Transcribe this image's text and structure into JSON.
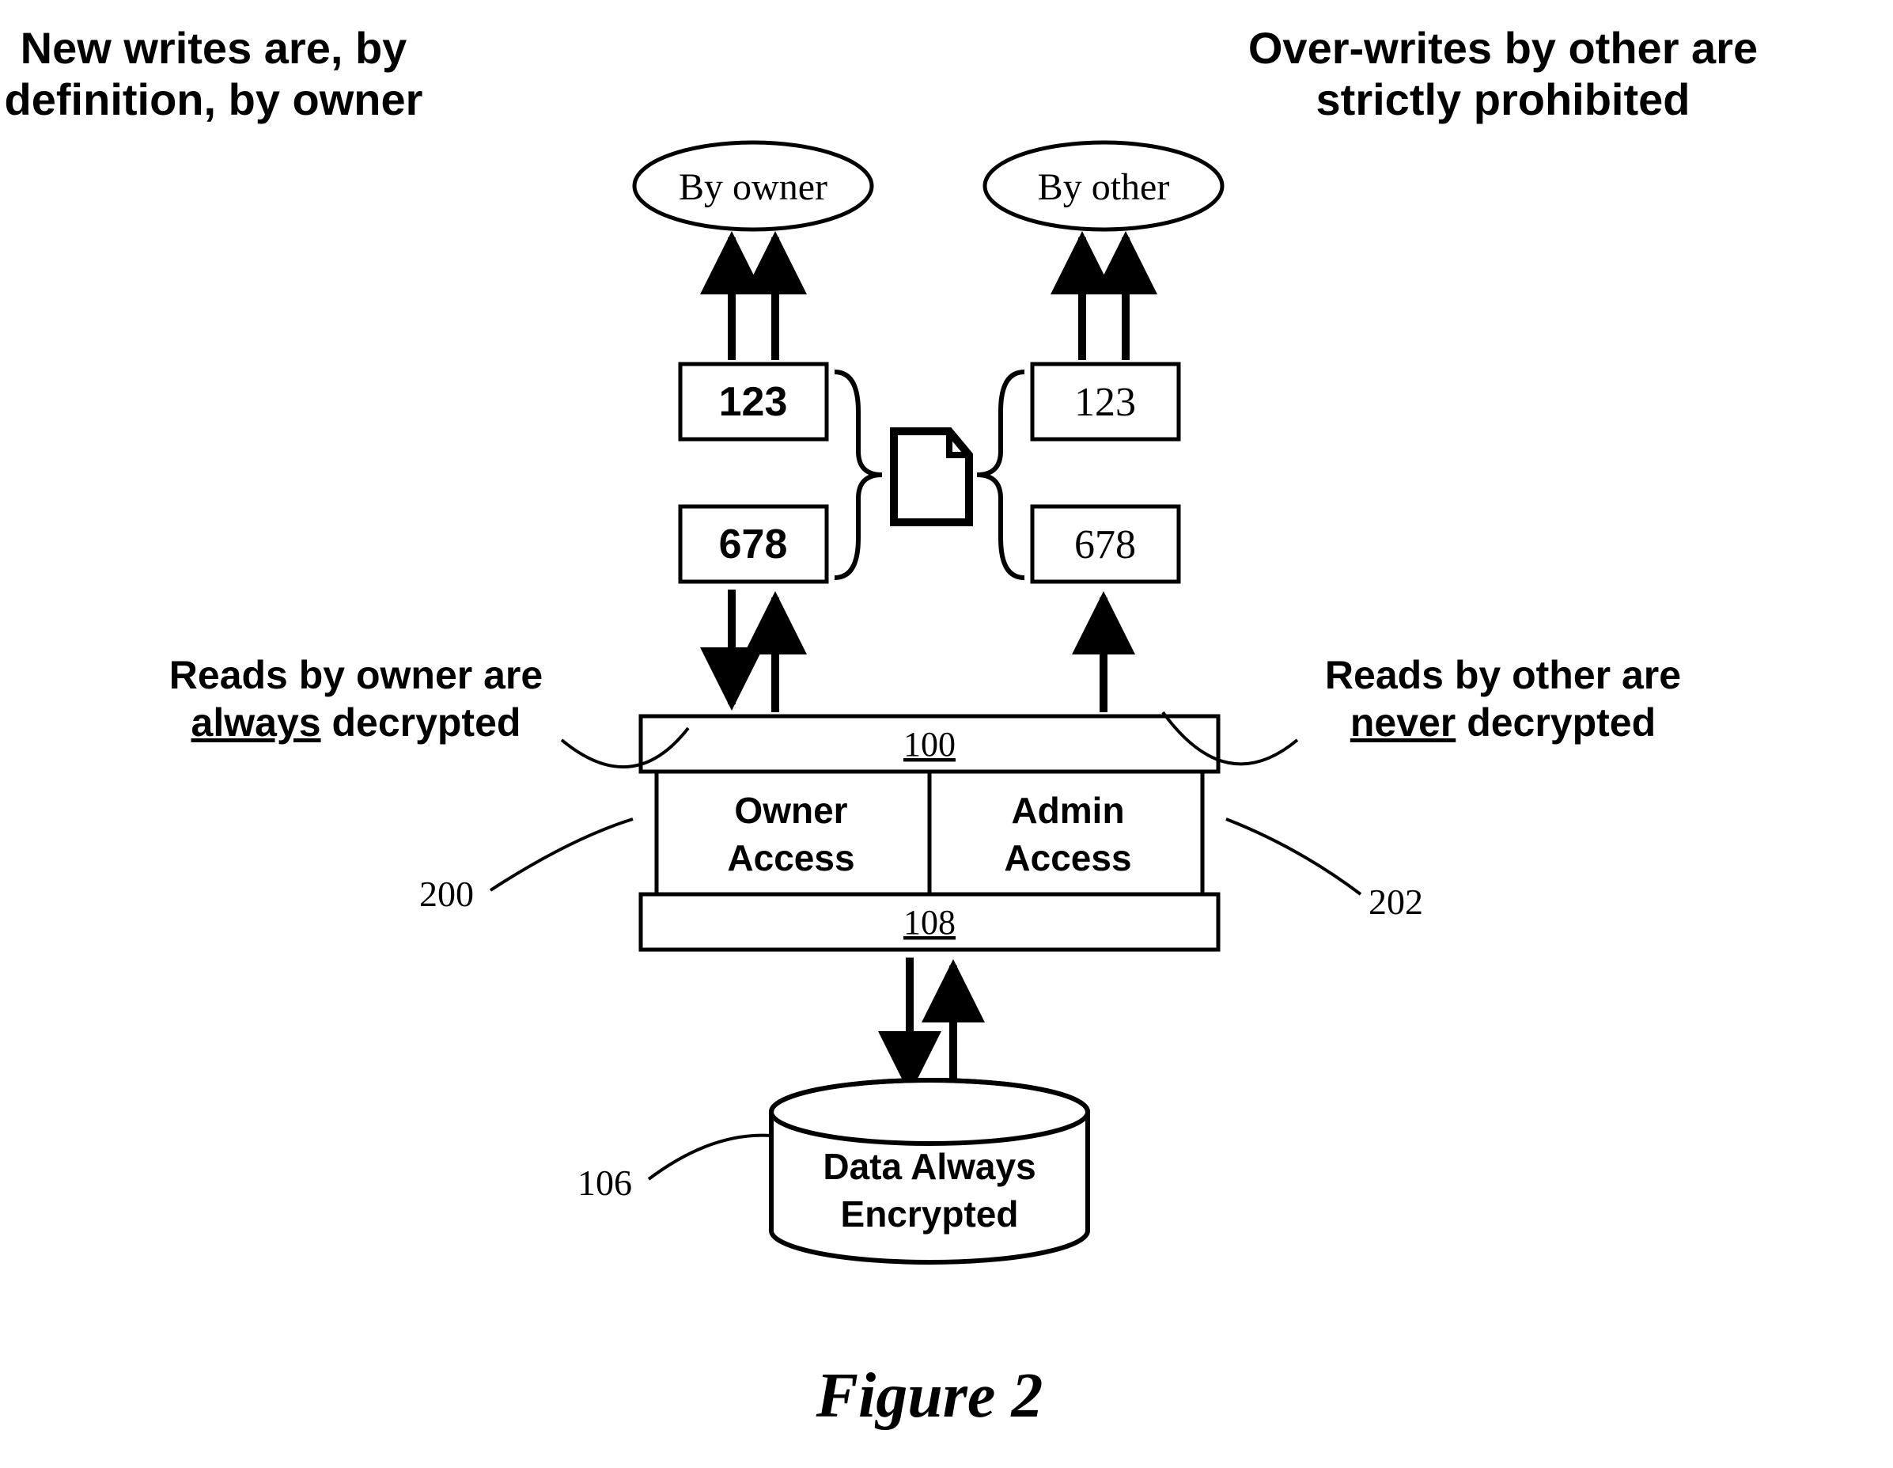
{
  "header": {
    "left_line1": "New writes are, by",
    "left_line2": "definition, by owner",
    "right_line1": "Over-writes by other are",
    "right_line2": "strictly prohibited"
  },
  "ellipses": {
    "owner": "By owner",
    "other": "By other"
  },
  "data_boxes": {
    "left_top": "123",
    "left_bottom": "678",
    "right_top": "123",
    "right_bottom": "678"
  },
  "mid_labels": {
    "left_prefix": "Reads by owner are",
    "left_word": "always",
    "left_suffix": "decrypted",
    "right_prefix": "Reads by other are",
    "right_word": "never",
    "right_suffix": "decrypted"
  },
  "access_box": {
    "top_ref": "100",
    "left_line1": "Owner",
    "left_line2": "Access",
    "right_line1": "Admin",
    "right_line2": "Access",
    "bottom_ref": "108"
  },
  "refs": {
    "left": "200",
    "right": "202",
    "db": "106"
  },
  "database": {
    "line1": "Data Always",
    "line2": "Encrypted"
  },
  "caption": "Figure 2"
}
